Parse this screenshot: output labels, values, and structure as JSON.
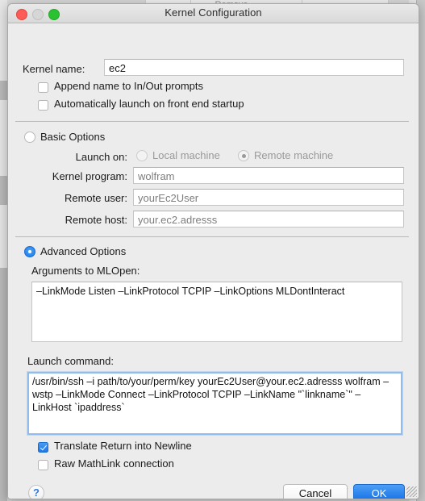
{
  "background_window": {
    "partial_label_top": "Remove",
    "partial_label_right": "Re"
  },
  "window": {
    "title": "Kernel Configuration",
    "controls": {
      "close": "close-button",
      "minimize": "minimize-button",
      "zoom": "zoom-button"
    }
  },
  "form": {
    "kernel_name": {
      "label": "Kernel name:",
      "value": "ec2",
      "placeholder": ""
    },
    "append_name": {
      "label": "Append name to In/Out prompts",
      "checked": false
    },
    "auto_launch": {
      "label": "Automatically launch on front end startup",
      "checked": false
    }
  },
  "basic_options": {
    "label": "Basic Options",
    "selected": false,
    "launch_on": {
      "label": "Launch on:",
      "options": [
        {
          "label": "Local machine",
          "selected": false
        },
        {
          "label": "Remote machine",
          "selected": true
        }
      ]
    },
    "fields": [
      {
        "label": "Kernel program:",
        "value": "wolfram"
      },
      {
        "label": "Remote user:",
        "value": "yourEc2User"
      },
      {
        "label": "Remote host:",
        "value": "your.ec2.adresss"
      }
    ]
  },
  "advanced_options": {
    "label": "Advanced Options",
    "selected": true,
    "arguments": {
      "label": "Arguments to MLOpen:",
      "value": "–LinkMode Listen –LinkProtocol TCPIP –LinkOptions MLDontInteract"
    },
    "launch_command": {
      "label": "Launch command:",
      "value": "/usr/bin/ssh –i path/to/your/perm/key yourEc2User@your.ec2.adresss wolfram –wstp –LinkMode Connect –LinkProtocol TCPIP –LinkName \"`linkname`\" –LinkHost `ipaddress`",
      "focused": true
    }
  },
  "options": {
    "translate_return": {
      "label": "Translate Return into Newline",
      "checked": true
    },
    "raw_mathlink": {
      "label": "Raw MathLink connection",
      "checked": false
    }
  },
  "footer": {
    "help_label": "?",
    "cancel_label": "Cancel",
    "ok_label": "OK"
  },
  "colors": {
    "accent": "#1878ea",
    "window_bg": "#ececec",
    "field_bg": "#ffffff",
    "focus_ring": "#8fbdf0"
  }
}
